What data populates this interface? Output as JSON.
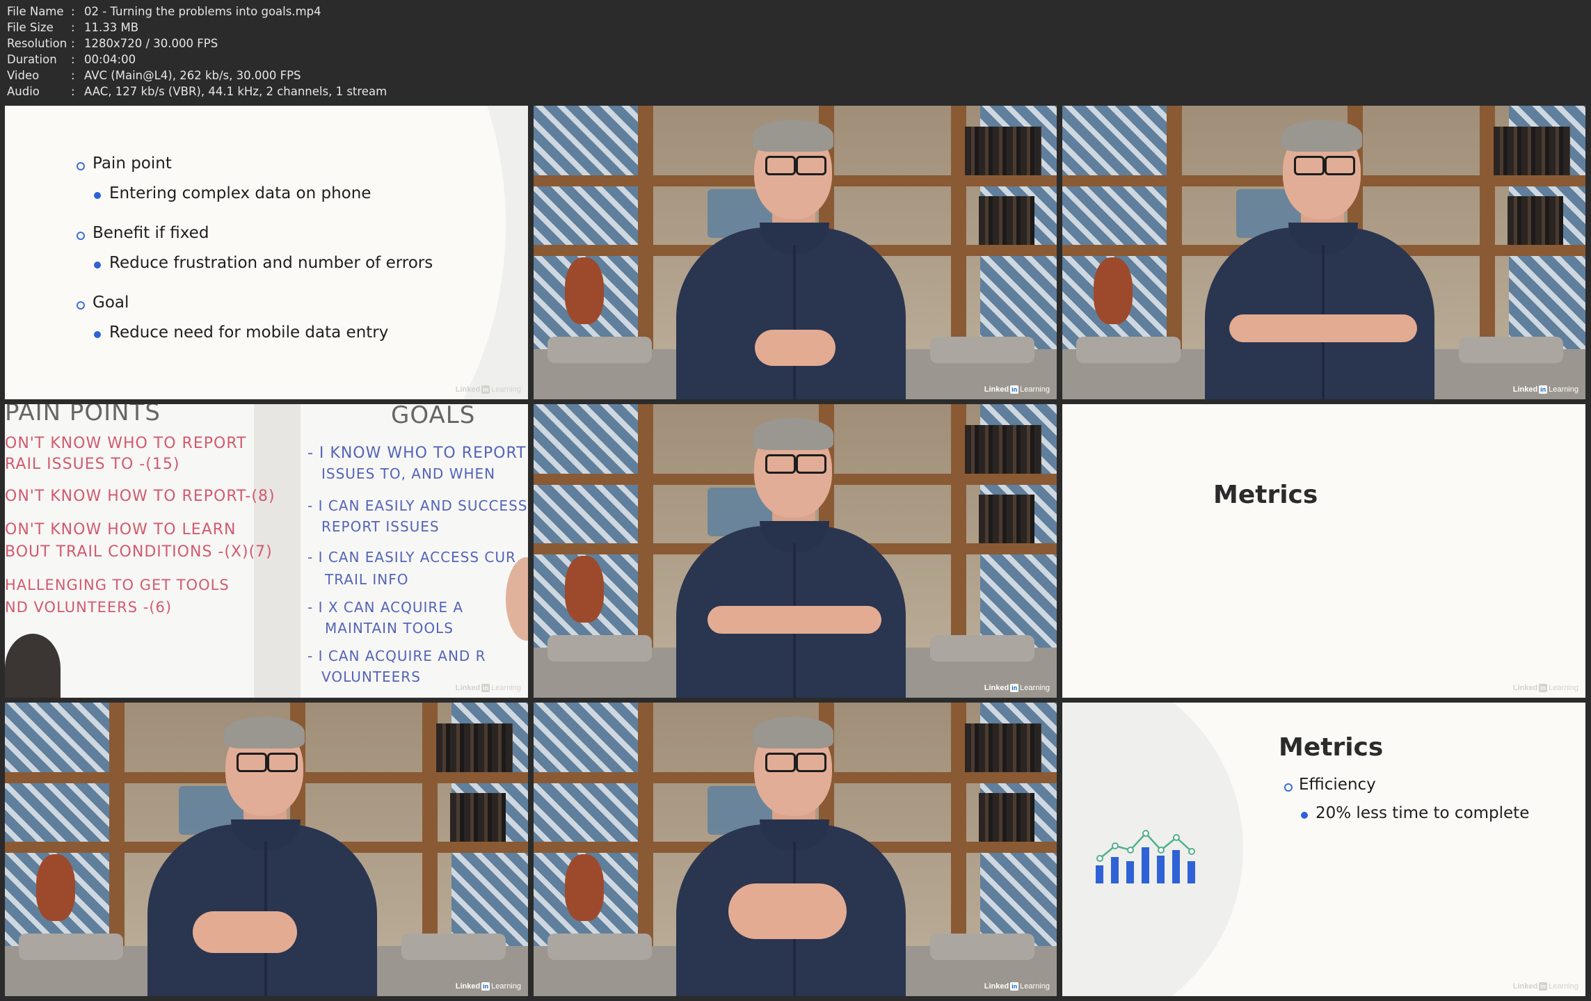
{
  "info": {
    "rows": [
      {
        "key": "File Name",
        "sep": ":",
        "value": "02 - Turning the problems into goals.mp4"
      },
      {
        "key": "File Size",
        "sep": ":",
        "value": "11.33 MB"
      },
      {
        "key": "Resolution",
        "sep": ":",
        "value": "1280x720 / 30.000 FPS"
      },
      {
        "key": "Duration",
        "sep": ":",
        "value": "00:04:00"
      },
      {
        "key": "Video",
        "sep": ":",
        "value": "AVC (Main@L4), 262 kb/s, 30.000 FPS"
      },
      {
        "key": "Audio",
        "sep": ":",
        "value": "AAC, 127 kb/s (VBR), 44.1 kHz, 2 channels, 1 stream"
      }
    ]
  },
  "watermark": {
    "brand": "Linked",
    "in": "in",
    "suffix": "Learning"
  },
  "slide1": {
    "items": [
      {
        "label": "Pain point",
        "sub": "Entering complex data on phone"
      },
      {
        "label": "Benefit if fixed",
        "sub": "Reduce frustration and number of errors"
      },
      {
        "label": "Goal",
        "sub": "Reduce need for mobile data entry"
      }
    ]
  },
  "whiteboard": {
    "left_heading": "PAIN POINTS",
    "left_lines": [
      "ON'T KNOW WHO TO REPORT",
      "RAIL ISSUES TO -(15)",
      "ON'T KNOW HOW TO REPORT-(8)",
      "ON'T KNOW HOW TO LEARN",
      "BOUT TRAIL CONDITIONS -(X)(7)",
      "HALLENGING TO GET TOOLS",
      "ND VOLUNTEERS -(6)"
    ],
    "right_heading": "GOALS",
    "right_lines": [
      "- I KNOW WHO TO REPORT",
      "ISSUES TO, AND WHEN",
      "- I CAN EASILY AND SUCCESS",
      "REPORT ISSUES",
      "- I CAN EASILY ACCESS CUR",
      "TRAIL INFO",
      "- I X CAN ACQUIRE A",
      "MAINTAIN TOOLS",
      "- I CAN ACQUIRE AND R",
      "VOLUNTEERS"
    ]
  },
  "slide_metrics_title": "Metrics",
  "slide_metrics2": {
    "title": "Metrics",
    "item": "Efficiency",
    "sub": "20% less time to complete"
  },
  "colors": {
    "accent": "#2f62d6",
    "ring": "#3a6fd8",
    "chart_line": "#4fb08c"
  }
}
